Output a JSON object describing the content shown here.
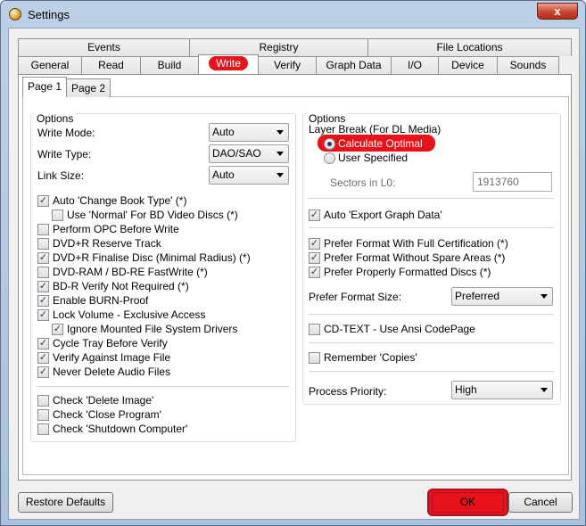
{
  "window": {
    "title": "Settings",
    "close": "x"
  },
  "tabs_row1": [
    "Events",
    "Registry",
    "File Locations"
  ],
  "tabs_row2": [
    "General",
    "Read",
    "Build",
    "Write",
    "Verify",
    "Graph Data",
    "I/O",
    "Device",
    "Sounds"
  ],
  "subtabs": [
    "Page 1",
    "Page 2"
  ],
  "left": {
    "group_title": "Options",
    "write_mode_label": "Write Mode:",
    "write_mode_value": "Auto",
    "write_type_label": "Write Type:",
    "write_type_value": "DAO/SAO",
    "link_size_label": "Link Size:",
    "link_size_value": "Auto",
    "checks": [
      {
        "label": "Auto 'Change Book Type' (*)",
        "checked": true
      },
      {
        "label": "Use 'Normal' For BD Video Discs (*)",
        "checked": false
      },
      {
        "label": "Perform OPC Before Write",
        "checked": false
      },
      {
        "label": "DVD+R Reserve Track",
        "checked": false
      },
      {
        "label": "DVD+R Finalise Disc (Minimal Radius) (*)",
        "checked": true
      },
      {
        "label": "DVD-RAM / BD-RE FastWrite (*)",
        "checked": false
      },
      {
        "label": "BD-R Verify Not Required (*)",
        "checked": true
      },
      {
        "label": "Enable BURN-Proof",
        "checked": true
      },
      {
        "label": "Lock Volume - Exclusive Access",
        "checked": true
      },
      {
        "label": "Ignore Mounted File System Drivers",
        "checked": true
      },
      {
        "label": "Cycle Tray Before Verify",
        "checked": true
      },
      {
        "label": "Verify Against Image File",
        "checked": true
      },
      {
        "label": "Never Delete Audio Files",
        "checked": true
      },
      {
        "label": "Check 'Delete Image'",
        "checked": false
      },
      {
        "label": "Check 'Close Program'",
        "checked": false
      },
      {
        "label": "Check 'Shutdown Computer'",
        "checked": false
      }
    ]
  },
  "right": {
    "group_title": "Options",
    "layer_break_label": "Layer Break (For DL Media)",
    "radio_calc": "Calculate Optimal",
    "radio_user": "User Specified",
    "sectors_label": "Sectors in L0:",
    "sectors_value": "1913760",
    "auto_export": "Auto 'Export Graph Data'",
    "prefer_full_cert": "Prefer Format With Full Certification (*)",
    "prefer_no_spare": "Prefer Format Without Spare Areas (*)",
    "prefer_properly": "Prefer Properly Formatted Discs (*)",
    "format_size_label": "Prefer Format Size:",
    "format_size_value": "Preferred",
    "cdtext": "CD-TEXT - Use Ansi CodePage",
    "remember_copies": "Remember 'Copies'",
    "priority_label": "Process Priority:",
    "priority_value": "High"
  },
  "buttons": {
    "restore": "Restore Defaults",
    "ok": "OK",
    "cancel": "Cancel"
  },
  "colors": {
    "highlight": "#e8121a",
    "title_bg": "#bcd1e8"
  }
}
